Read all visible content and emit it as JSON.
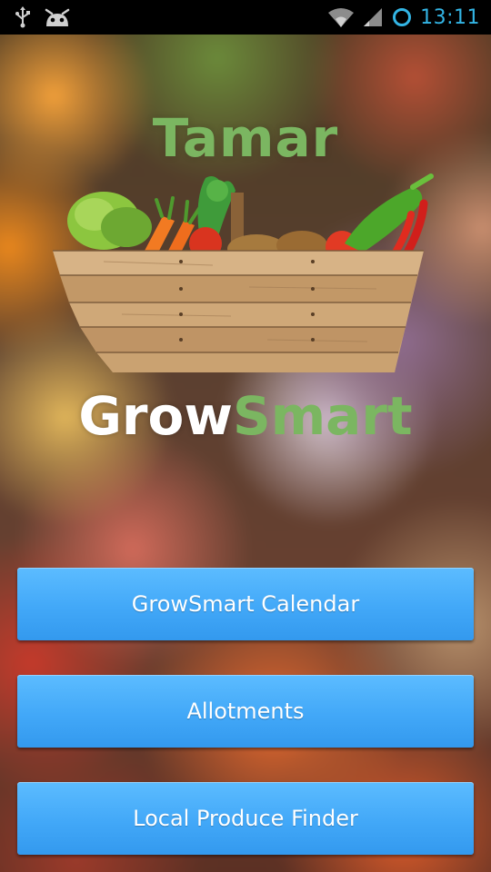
{
  "status_bar": {
    "time": "13:11",
    "icons": [
      "usb-icon",
      "android-debug-icon",
      "wifi-icon",
      "signal-icon",
      "sync-ring-icon"
    ],
    "clock_color": "#33b5e5"
  },
  "logo": {
    "top_text": "Tamar",
    "word_white": "Grow",
    "word_green": "Smart",
    "brand_green": "#7bb661"
  },
  "menu": {
    "calendar_label": "GrowSmart Calendar",
    "allotments_label": "Allotments",
    "finder_label": "Local Produce Finder",
    "button_color": "#42a8f8"
  }
}
